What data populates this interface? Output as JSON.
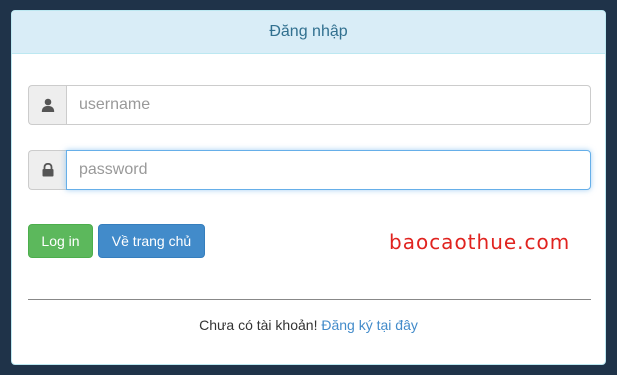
{
  "panel": {
    "title": "Đăng nhập"
  },
  "form": {
    "username_placeholder": "username",
    "password_placeholder": "password",
    "username_icon": "user-icon",
    "password_icon": "lock-icon"
  },
  "buttons": {
    "login_label": "Log in",
    "home_label": "Về trang chủ"
  },
  "watermark": "baocaothue.com",
  "footer": {
    "text": "Chưa có tài khoản!",
    "register_link": "Đăng ký tại đây"
  },
  "colors": {
    "background": "#1f3349",
    "heading_bg": "#d9edf7",
    "heading_text": "#31708f",
    "login_button": "#5cb85c",
    "home_button": "#428bca",
    "watermark": "#e0231f",
    "link": "#428bca"
  }
}
